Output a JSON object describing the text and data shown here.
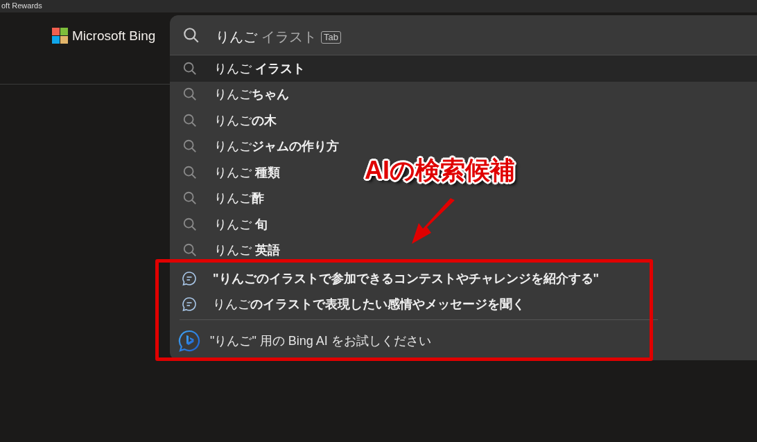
{
  "top_bar": {
    "title": "oft Rewards"
  },
  "logo": {
    "text": "Microsoft Bing"
  },
  "search": {
    "typed": "りんご",
    "completion": "イラスト",
    "key_hint": "Tab"
  },
  "suggestions": [
    {
      "text": "りんご **イラスト**",
      "selected": true
    },
    {
      "text": "りんご**ちゃん**",
      "selected": false
    },
    {
      "text": "りんご**の木**",
      "selected": false
    },
    {
      "text": "りんご**ジャムの作り方**",
      "selected": false
    },
    {
      "text": "りんご **種類**",
      "selected": false
    },
    {
      "text": "りんご**酢**",
      "selected": false
    },
    {
      "text": "りんご **旬**",
      "selected": false
    },
    {
      "text": "りんご **英語**",
      "selected": false
    }
  ],
  "ai_suggestions": [
    {
      "text": "\"りんごのイラストで参加できるコンテストやチャレンジを紹介する\"",
      "bold": true
    },
    {
      "text": "りんご**のイラストで表現したい感情やメッセージを聞く**",
      "bold": false
    }
  ],
  "try_ai": {
    "text": "\"りんご\" 用の Bing AI をお試しください"
  },
  "annotation": {
    "label": "AIの検索候補"
  }
}
